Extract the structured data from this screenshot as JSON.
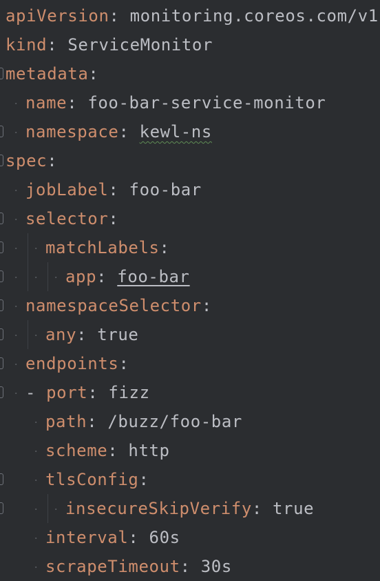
{
  "editor": {
    "language": "yaml",
    "colors": {
      "background": "#2b2d30",
      "key": "#cf8e6d",
      "text": "#bcbec4",
      "typo_underline": "#5f8c55"
    },
    "lines": [
      {
        "key": "apiVersion",
        "sep": ": ",
        "value": "monitoring.coreos.com/v1"
      },
      {
        "key": "kind",
        "sep": ": ",
        "value": "ServiceMonitor"
      },
      {
        "key": "metadata",
        "sep": ":",
        "value": ""
      },
      {
        "key": "name",
        "sep": ": ",
        "value": "foo-bar-service-monitor"
      },
      {
        "key": "namespace",
        "sep": ": ",
        "value": "kewl-ns"
      },
      {
        "key": "spec",
        "sep": ":",
        "value": ""
      },
      {
        "key": "jobLabel",
        "sep": ": ",
        "value": "foo-bar"
      },
      {
        "key": "selector",
        "sep": ":",
        "value": ""
      },
      {
        "key": "matchLabels",
        "sep": ":",
        "value": ""
      },
      {
        "key": "app",
        "sep": ": ",
        "value": "foo-bar"
      },
      {
        "key": "namespaceSelector",
        "sep": ":",
        "value": ""
      },
      {
        "key": "any",
        "sep": ": ",
        "value": "true"
      },
      {
        "key": "endpoints",
        "sep": ":",
        "value": ""
      },
      {
        "dash": "- ",
        "key": "port",
        "sep": ": ",
        "value": "fizz"
      },
      {
        "key": "path",
        "sep": ": ",
        "value": "/buzz/foo-bar"
      },
      {
        "key": "scheme",
        "sep": ": ",
        "value": "http"
      },
      {
        "key": "tlsConfig",
        "sep": ":",
        "value": ""
      },
      {
        "key": "insecureSkipVerify",
        "sep": ": ",
        "value": "true"
      },
      {
        "key": "interval",
        "sep": ": ",
        "value": "60s"
      },
      {
        "key": "scrapeTimeout",
        "sep": ": ",
        "value": "30s"
      }
    ]
  }
}
